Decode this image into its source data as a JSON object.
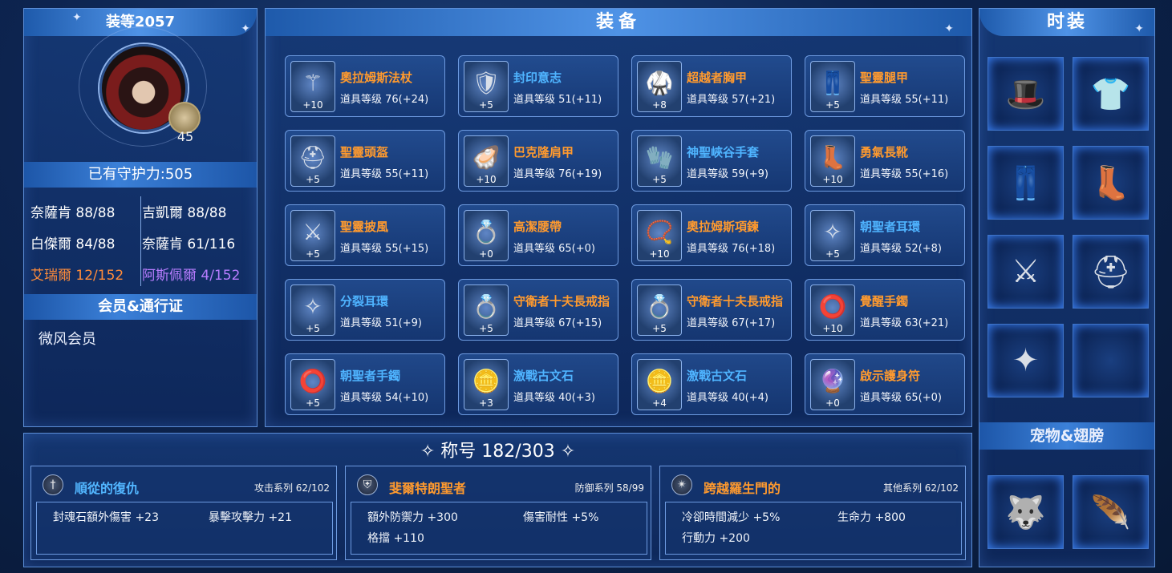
{
  "left": {
    "header": "装等2057",
    "level": "45",
    "guard": "已有守护力:505",
    "stats": [
      {
        "label": "奈薩肯 88/88",
        "color": "white"
      },
      {
        "label": "吉凱爾 88/88",
        "color": "white"
      },
      {
        "label": "白傑爾 84/88",
        "color": "white"
      },
      {
        "label": "奈薩肯 61/116",
        "color": "white"
      },
      {
        "label": "艾瑞爾 12/152",
        "color": "orange"
      },
      {
        "label": "阿斯佩爾 4/152",
        "color": "purple"
      }
    ],
    "member_header": "会员&通行证",
    "member_value": "微风会员"
  },
  "equip": {
    "header": "装备",
    "items": [
      {
        "name": "奧拉姆斯法杖",
        "level": "道具等级 76(+24)",
        "plus": "+10",
        "color": "orange",
        "icon": "staff-icon"
      },
      {
        "name": "封印意志",
        "level": "道具等级 51(+11)",
        "plus": "+5",
        "color": "blue",
        "icon": "offhand-icon"
      },
      {
        "name": "超越者胸甲",
        "level": "道具等级 57(+21)",
        "plus": "+8",
        "color": "orange",
        "icon": "chest-armor-icon"
      },
      {
        "name": "聖靈腿甲",
        "level": "道具等级 55(+11)",
        "plus": "+5",
        "color": "orange",
        "icon": "leg-armor-icon"
      },
      {
        "name": "聖靈頭盔",
        "level": "道具等级 55(+11)",
        "plus": "+5",
        "color": "orange",
        "icon": "helmet-icon"
      },
      {
        "name": "巴克隆肩甲",
        "level": "道具等级 76(+19)",
        "plus": "+10",
        "color": "orange",
        "icon": "shoulder-icon"
      },
      {
        "name": "神聖峽谷手套",
        "level": "道具等级 59(+9)",
        "plus": "+5",
        "color": "blue",
        "icon": "gloves-icon"
      },
      {
        "name": "勇氣長靴",
        "level": "道具等级 55(+16)",
        "plus": "+10",
        "color": "orange",
        "icon": "boots-icon"
      },
      {
        "name": "聖靈披風",
        "level": "道具等级 55(+15)",
        "plus": "+5",
        "color": "orange",
        "icon": "cape-icon"
      },
      {
        "name": "高潔腰帶",
        "level": "道具等级 65(+0)",
        "plus": "+0",
        "color": "orange",
        "icon": "belt-icon"
      },
      {
        "name": "奧拉姆斯項鍊",
        "level": "道具等级 76(+18)",
        "plus": "+10",
        "color": "orange",
        "icon": "necklace-icon"
      },
      {
        "name": "朝聖者耳環",
        "level": "道具等级 52(+8)",
        "plus": "+5",
        "color": "blue",
        "icon": "earring-icon"
      },
      {
        "name": "分裂耳環",
        "level": "道具等级 51(+9)",
        "plus": "+5",
        "color": "blue",
        "icon": "earring-icon"
      },
      {
        "name": "守衛者十夫長戒指",
        "level": "道具等级 67(+15)",
        "plus": "+5",
        "color": "orange",
        "icon": "ring-icon"
      },
      {
        "name": "守衛者十夫長戒指",
        "level": "道具等级 67(+17)",
        "plus": "+5",
        "color": "orange",
        "icon": "ring-icon"
      },
      {
        "name": "覺醒手鐲",
        "level": "道具等级 63(+21)",
        "plus": "+10",
        "color": "orange",
        "icon": "bracelet-icon"
      },
      {
        "name": "朝聖者手鐲",
        "level": "道具等级 54(+10)",
        "plus": "+5",
        "color": "blue",
        "icon": "bracelet-icon"
      },
      {
        "name": "激戰古文石",
        "level": "道具等级 40(+3)",
        "plus": "+3",
        "color": "blue",
        "icon": "rune-stone-icon"
      },
      {
        "name": "激戰古文石",
        "level": "道具等级 40(+4)",
        "plus": "+4",
        "color": "blue",
        "icon": "rune-stone-icon"
      },
      {
        "name": "啟示護身符",
        "level": "道具等级 65(+0)",
        "plus": "+0",
        "color": "orange",
        "icon": "amulet-icon"
      }
    ]
  },
  "fashion": {
    "header": "时装",
    "items": [
      "hat-icon",
      "shirt-icon",
      "pants-icon",
      "boots-icon",
      "cape-icon",
      "helmet-icon",
      "weapon-icon",
      "empty-slot"
    ],
    "pet_header": "宠物&翅膀",
    "pets": [
      "pet-icon",
      "wings-icon"
    ]
  },
  "title": {
    "header": "称号 182/303",
    "cards": [
      {
        "name": "順從的復仇",
        "series": "攻击系列 62/102",
        "color": "blue",
        "attrs": [
          "封魂石額外傷害 +23",
          "暴擊攻擊力 +21"
        ]
      },
      {
        "name": "斐爾特朗聖者",
        "series": "防御系列 58/99",
        "color": "orange",
        "attrs": [
          "額外防禦力 +300",
          "傷害耐性 +5%",
          "格擋 +110"
        ]
      },
      {
        "name": "跨越羅生門的",
        "series": "其他系列 62/102",
        "color": "orange",
        "attrs": [
          "冷卻時間減少 +5%",
          "生命力 +800",
          "行動力 +200"
        ]
      }
    ]
  },
  "colors": {
    "orange": "#ff9a2e",
    "blue": "#4fb4ff",
    "purple": "#b77dff",
    "accent": "#3b80d8"
  }
}
